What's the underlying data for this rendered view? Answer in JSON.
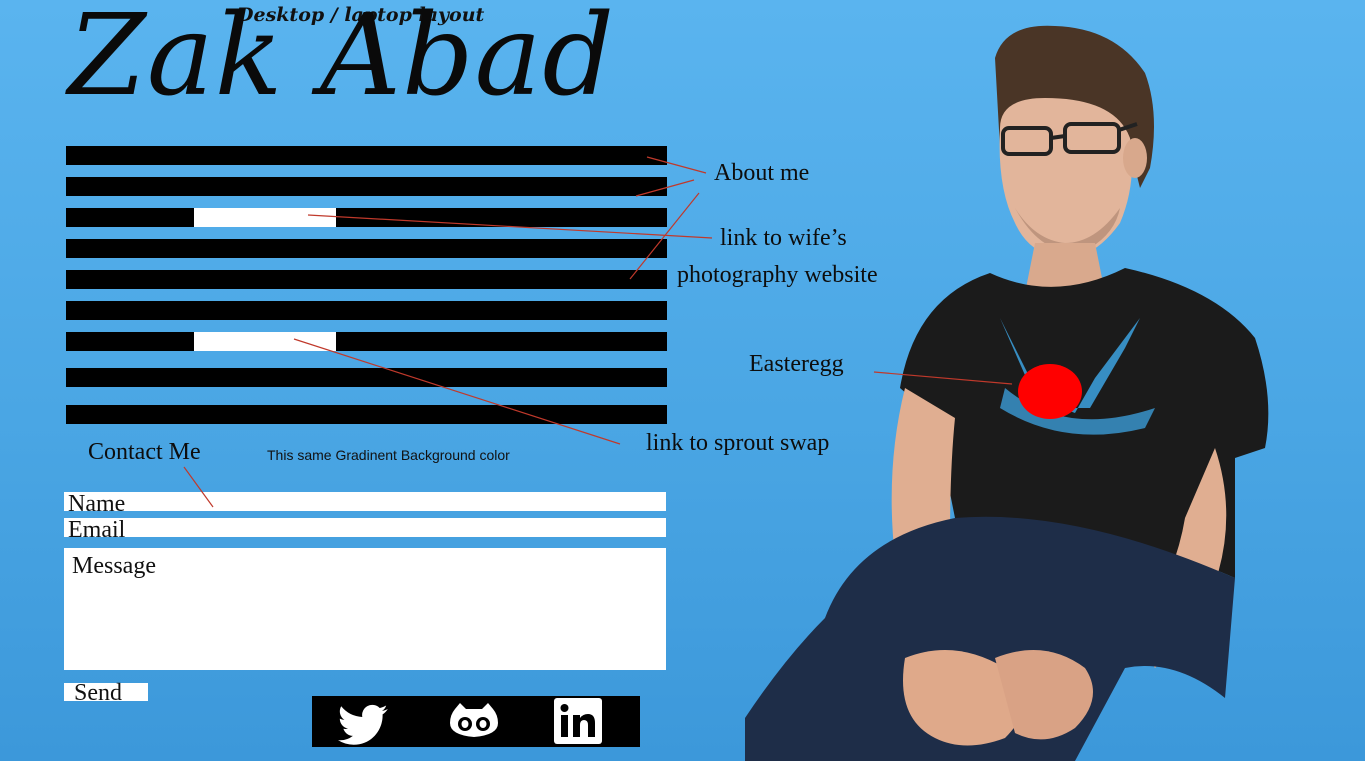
{
  "header": {
    "subtitle": "Desktop / laptop layout",
    "title": "Zak Abad"
  },
  "annotations": {
    "about": "About me",
    "wife_link_line1": "link to wife’s",
    "wife_link_line2": "photography website",
    "easteregg": "Easteregg",
    "sprout": "link to sprout swap",
    "contact": "Contact Me",
    "gradient_note": "This same Gradinent Background color"
  },
  "form": {
    "name_placeholder": "Name",
    "email_placeholder": "Email",
    "message_placeholder": "Message",
    "send_label": "Send"
  },
  "social": {
    "icons": [
      "twitter-icon",
      "github-icon",
      "linkedin-icon"
    ]
  },
  "colors": {
    "background": "#4aa6e4",
    "easteregg": "#ff0000",
    "annotation_line": "#c0392b"
  }
}
